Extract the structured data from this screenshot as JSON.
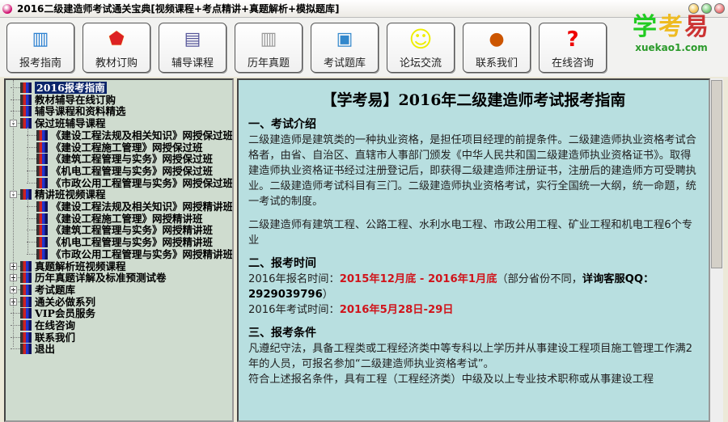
{
  "window": {
    "title": "2016二级建造师考试通关宝典[视频课程+考点精讲+真题解析+模拟题库]"
  },
  "toolbar": [
    {
      "label": "报考指南",
      "icon": "guide-icon"
    },
    {
      "label": "教材订购",
      "icon": "book-order-icon"
    },
    {
      "label": "辅导课程",
      "icon": "course-icon"
    },
    {
      "label": "历年真题",
      "icon": "past-papers-icon"
    },
    {
      "label": "考试题库",
      "icon": "question-bank-icon"
    },
    {
      "label": "论坛交流",
      "icon": "smiley-icon"
    },
    {
      "label": "联系我们",
      "icon": "contact-icon"
    },
    {
      "label": "在线咨询",
      "icon": "question-icon"
    }
  ],
  "logo": {
    "cn": "学考易",
    "en": "xuekao1.com"
  },
  "tree": [
    {
      "label": "2016报考指南",
      "level": 0,
      "selected": true
    },
    {
      "label": "教材辅导在线订购",
      "level": 0
    },
    {
      "label": "辅导课程和资料精选",
      "level": 0
    },
    {
      "label": "保过班辅导课程",
      "level": 0,
      "expander": "-"
    },
    {
      "label": "《建设工程法规及相关知识》网授保过班",
      "level": 1
    },
    {
      "label": "《建设工程施工管理》网授保过班",
      "level": 1
    },
    {
      "label": "《建筑工程管理与实务》网授保过班",
      "level": 1
    },
    {
      "label": "《机电工程管理与实务》网授保过班",
      "level": 1
    },
    {
      "label": "《市政公用工程管理与实务》网授保过班",
      "level": 1
    },
    {
      "label": "精讲班视频课程",
      "level": 0,
      "expander": "-"
    },
    {
      "label": "《建设工程法规及相关知识》网授精讲班",
      "level": 1
    },
    {
      "label": "《建设工程施工管理》网授精讲班",
      "level": 1
    },
    {
      "label": "《建筑工程管理与实务》网授精讲班",
      "level": 1
    },
    {
      "label": "《机电工程管理与实务》网授精讲班",
      "level": 1
    },
    {
      "label": "《市政公用工程管理与实务》网授精讲班",
      "level": 1
    },
    {
      "label": "真题解析班视频课程",
      "level": 0,
      "expander": "+"
    },
    {
      "label": "历年真题详解及标准预测试卷",
      "level": 0,
      "expander": "+"
    },
    {
      "label": "考试题库",
      "level": 0,
      "expander": "+"
    },
    {
      "label": "通关必做系列",
      "level": 0,
      "expander": "+"
    },
    {
      "label": "VIP会员服务",
      "level": 0
    },
    {
      "label": "在线咨询",
      "level": 0
    },
    {
      "label": "联系我们",
      "level": 0
    },
    {
      "label": "退出",
      "level": 0
    }
  ],
  "content": {
    "title": "【学考易】2016年二级建造师考试报考指南",
    "s1_title": "一、考试介绍",
    "s1_p1": "二级建造师是建筑类的一种执业资格，是担任项目经理的前提条件。二级建造师执业资格考试合格者，由省、自治区、直辖市人事部门颁发《中华人民共和国二级建造师执业资格证书》。取得建造师执业资格证书经过注册登记后，即获得二级建造师注册证书，注册后的建造师方可受聘执业。二级建造师考试科目有三门。二级建造师执业资格考试，实行全国统一大纲，统一命题，统一考试的制度。",
    "s1_p2": "二级建造师有建筑工程、公路工程、水利水电工程、市政公用工程、矿业工程和机电工程6个专业",
    "s2_title": "二、报考时间",
    "reg_label": "2016年报名时间：",
    "reg_value": "2015年12月底 - 2016年1月底",
    "reg_note": "（部分省份不同，",
    "reg_qq": "详询客服QQ：2929039796",
    "reg_close": "）",
    "exam_label": "2016年考试时间：",
    "exam_value": "2016年5月28日-29日",
    "s3_title": "三、报考条件",
    "s3_p1": "凡遵纪守法，具备工程类或工程经济类中等专科以上学历并从事建设工程项目施工管理工作满2年的人员，可报名参加“二级建造师执业资格考试”。",
    "s3_p2": "符合上述报名条件，具有工程（工程经济类）中级及以上专业技术职称或从事建设工程"
  },
  "colors": {
    "tree_bg": "#cfdccf",
    "content_bg": "#b8dfe0",
    "highlight": "#d0141b"
  }
}
